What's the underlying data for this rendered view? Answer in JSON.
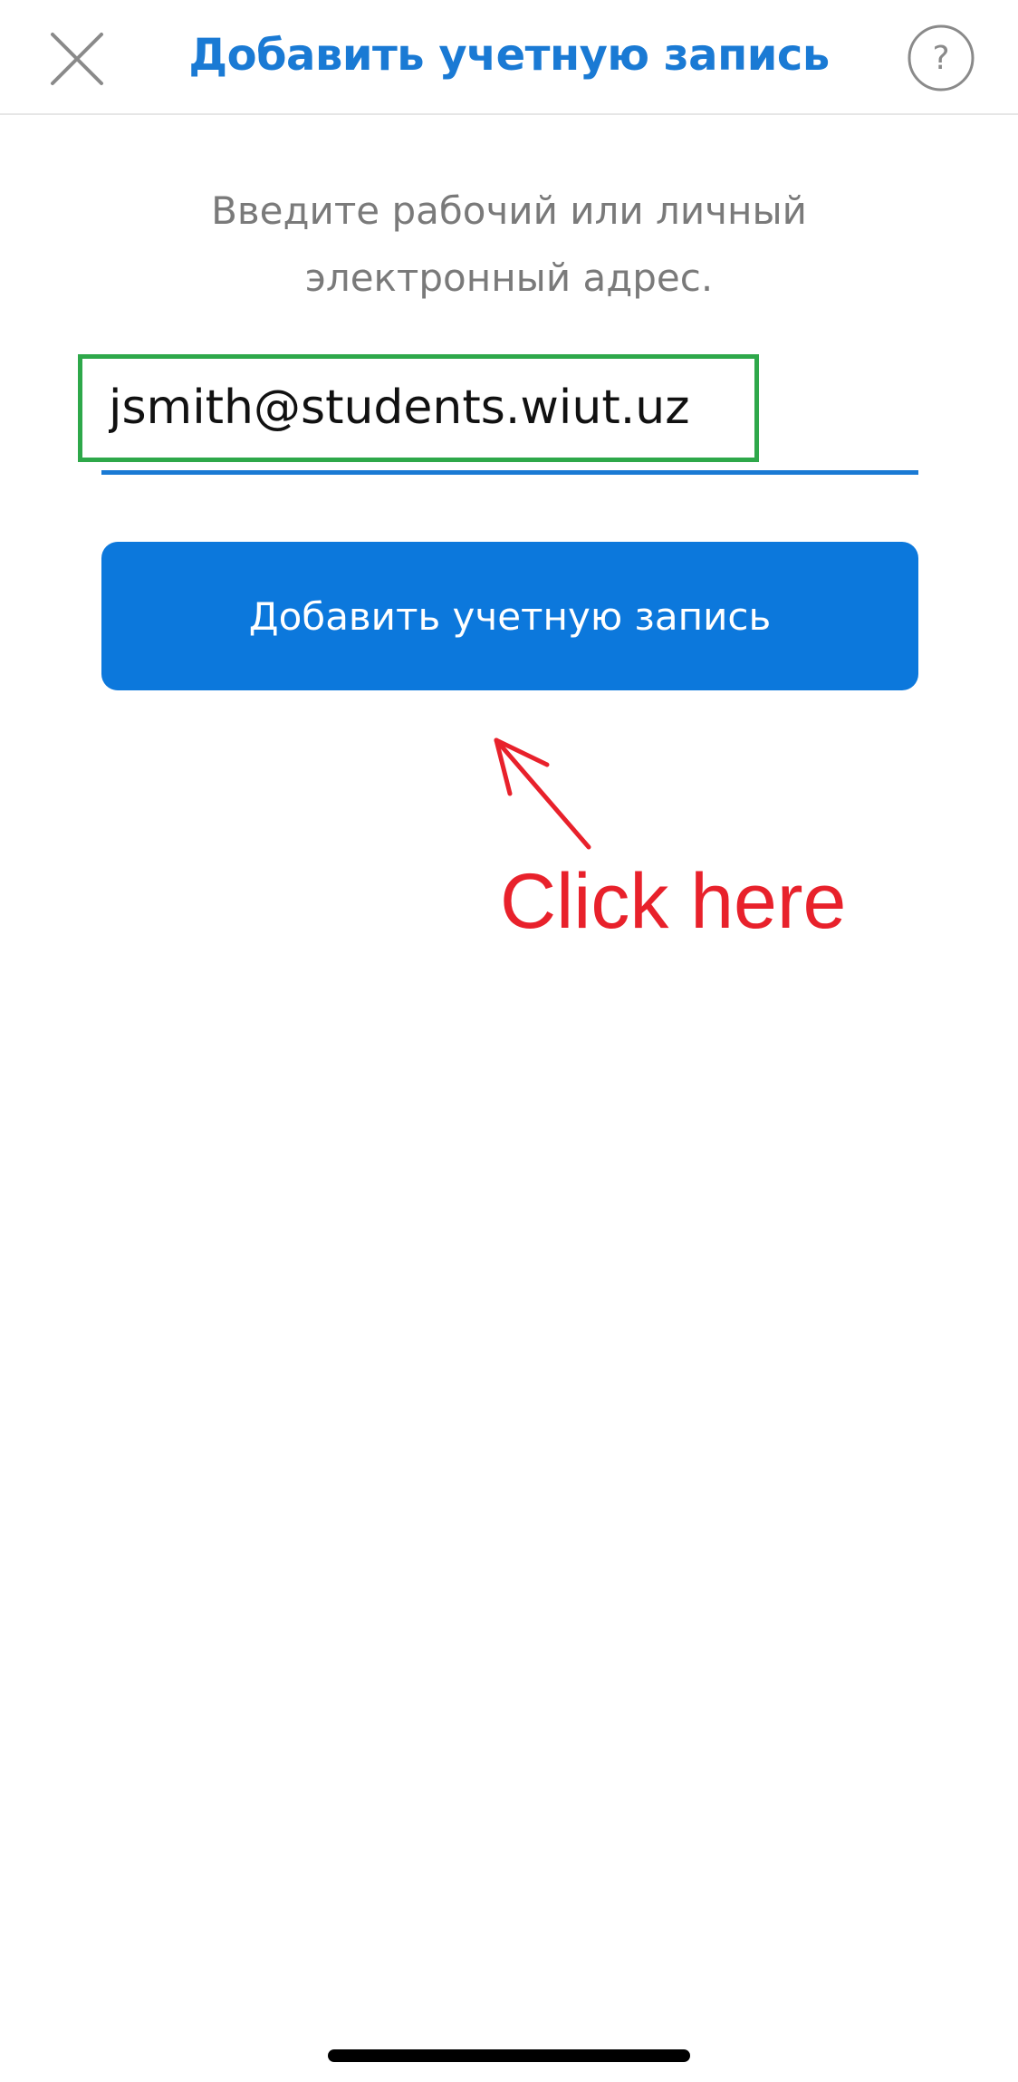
{
  "header": {
    "title": "Добавить учетную запись",
    "close_icon": "close-icon",
    "help_icon": "help-icon",
    "help_symbol": "?"
  },
  "instruction": {
    "line1": "Введите рабочий или личный",
    "line2": "электронный адрес."
  },
  "email": {
    "value": "jsmith@students.wiut.uz"
  },
  "add_button": {
    "label": "Добавить учетную запись"
  },
  "annotation": {
    "text": "Click here",
    "color": "#e8212b",
    "highlight_color": "#2ea84a"
  },
  "colors": {
    "accent": "#1a7ad4",
    "button": "#0c78dc"
  }
}
